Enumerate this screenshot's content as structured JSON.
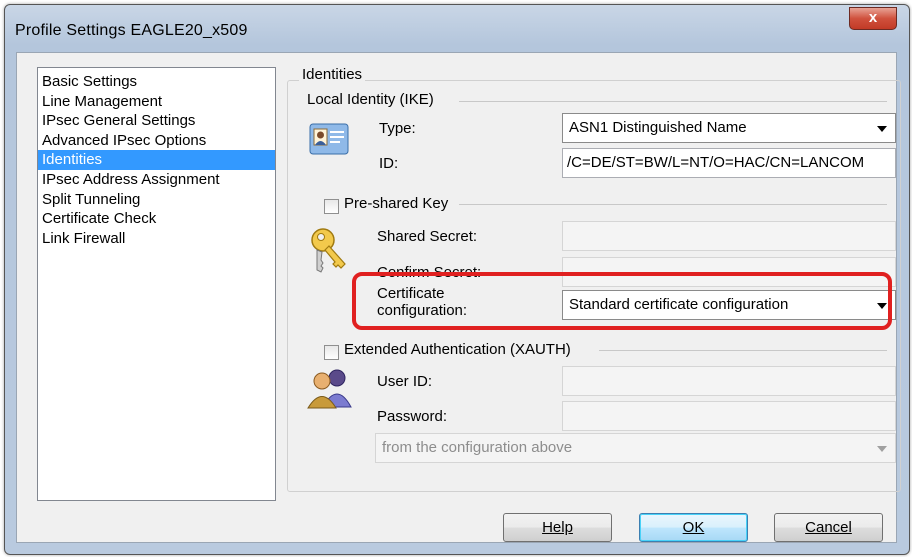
{
  "window": {
    "title": "Profile Settings   EAGLE20_x509",
    "close_label": "x"
  },
  "nav": {
    "items": [
      {
        "label": "Basic Settings",
        "selected": false
      },
      {
        "label": "Line Management",
        "selected": false
      },
      {
        "label": "IPsec General Settings",
        "selected": false
      },
      {
        "label": "Advanced IPsec Options",
        "selected": false
      },
      {
        "label": "Identities",
        "selected": true
      },
      {
        "label": "IPsec Address Assignment",
        "selected": false
      },
      {
        "label": "Split Tunneling",
        "selected": false
      },
      {
        "label": "Certificate Check",
        "selected": false
      },
      {
        "label": "Link Firewall",
        "selected": false
      }
    ]
  },
  "identities": {
    "section_title": "Identities",
    "local_identity": {
      "group_title": "Local Identity (IKE)",
      "icon": "id-card-icon",
      "type_label": "Type:",
      "type_value": "ASN1 Distinguished Name",
      "id_label": "ID:",
      "id_value": "/C=DE/ST=BW/L=NT/O=HAC/CN=LANCOM"
    },
    "preshared": {
      "checkbox_label": "Pre-shared Key",
      "checked": false,
      "icon": "keys-icon",
      "shared_secret_label": "Shared Secret:",
      "confirm_secret_label": "Confirm Secret:",
      "certificate_label": "Certificate configuration:",
      "certificate_label_line1": "Certificate",
      "certificate_label_line2": "configuration:",
      "certificate_value": "Standard certificate configuration"
    },
    "xauth": {
      "checkbox_label": "Extended Authentication (XAUTH)",
      "checked": false,
      "icon": "users-icon",
      "userid_label": "User ID:",
      "password_label": "Password:",
      "source_value": "from the configuration above"
    }
  },
  "buttons": {
    "help": "Help",
    "ok": "OK",
    "cancel": "Cancel"
  },
  "colors": {
    "selection": "#3399ff",
    "highlight_box": "#e02020"
  }
}
